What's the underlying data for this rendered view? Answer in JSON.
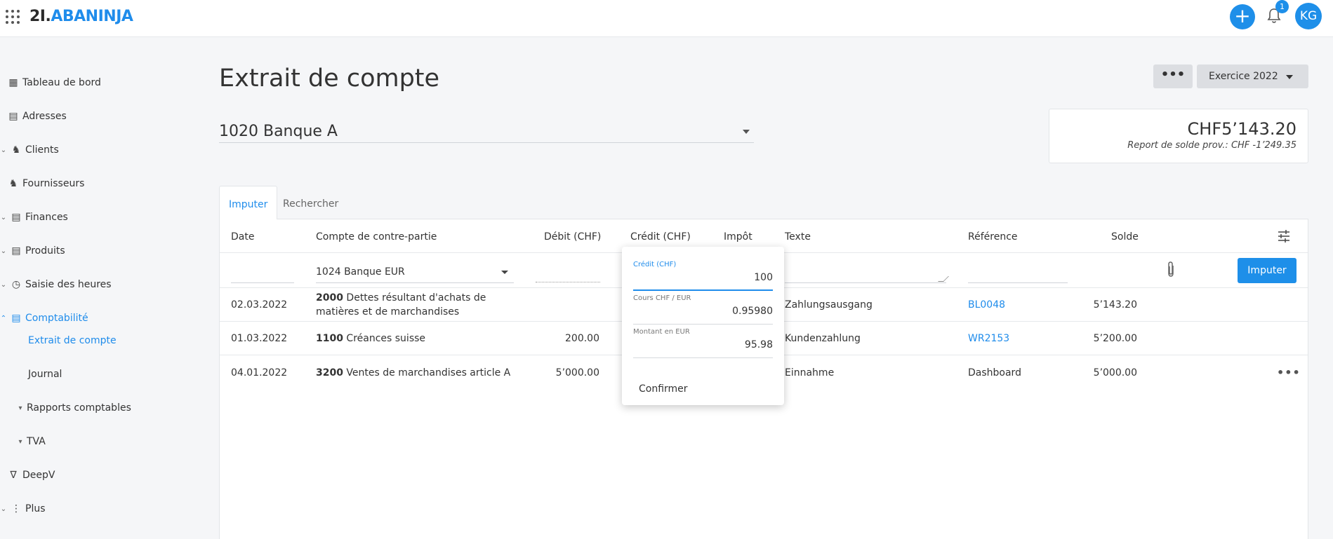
{
  "topbar": {
    "logo_prefix": "2I.",
    "logo_brand": "ABANINJA",
    "plus_label": "+",
    "notification_count": "1",
    "avatar_initials": "KG"
  },
  "sidebar": {
    "items": [
      {
        "label": "Tableau de bord",
        "icon": "dashboard-icon"
      },
      {
        "label": "Adresses",
        "icon": "address-book-icon"
      },
      {
        "label": "Clients",
        "icon": "clients-icon"
      },
      {
        "label": "Fournisseurs",
        "icon": "suppliers-icon"
      },
      {
        "label": "Finances",
        "icon": "finances-icon"
      },
      {
        "label": "Produits",
        "icon": "products-icon"
      },
      {
        "label": "Saisie des heures",
        "icon": "clock-icon"
      },
      {
        "label": "Comptabilité",
        "icon": "accounting-icon"
      },
      {
        "label": "Extrait de compte"
      },
      {
        "label": "Journal"
      },
      {
        "label": "Rapports comptables"
      },
      {
        "label": "TVA"
      },
      {
        "label": "DeepV",
        "icon": "deepv-icon"
      },
      {
        "label": "Plus",
        "icon": "more-vertical-icon"
      }
    ]
  },
  "header": {
    "title": "Extrait de compte",
    "more_label": "•••",
    "year_label": "Exercice 2022"
  },
  "account": {
    "selected": "1020 Banque A"
  },
  "balance": {
    "amount": "CHF5’143.20",
    "note": "Report de solde prov.: CHF -1’249.35"
  },
  "tabs": {
    "impute": "Imputer",
    "search": "Rechercher"
  },
  "table": {
    "columns": {
      "date": "Date",
      "contra": "Compte de contre-partie",
      "debit": "Débit (CHF)",
      "credit": "Crédit (CHF)",
      "tax": "Impôt",
      "text": "Texte",
      "ref": "Référence",
      "balance": "Solde"
    },
    "input_row": {
      "contra": "1024 Banque EUR",
      "submit": "Imputer"
    },
    "rows": [
      {
        "date": "02.03.2022",
        "account_no": "2000",
        "account_name": "Dettes résultant d'achats de",
        "account_name2": "matières et de marchandises",
        "debit": "",
        "text": "Zahlungsausgang",
        "ref": "BL0048",
        "balance": "5’143.20"
      },
      {
        "date": "01.03.2022",
        "account_no": "1100",
        "account_name": "Créances suisse",
        "debit": "200.00",
        "text": "Kundenzahlung",
        "ref": "WR2153",
        "balance": "5’200.00"
      },
      {
        "date": "04.01.2022",
        "account_no": "3200",
        "account_name": "Ventes de marchandises article A",
        "debit": "5’000.00",
        "text": "Einnahme",
        "ref": "Dashboard",
        "balance": "5’000.00"
      }
    ]
  },
  "popup": {
    "credit_label": "Crédit (CHF)",
    "credit_value": "100",
    "rate_label": "Cours CHF / EUR",
    "rate_value": "0.95980",
    "eur_label": "Montant en EUR",
    "eur_value": "95.98",
    "confirm": "Confirmer"
  },
  "colors": {
    "accent": "#1e8fe9",
    "background": "#f5f6f8"
  }
}
